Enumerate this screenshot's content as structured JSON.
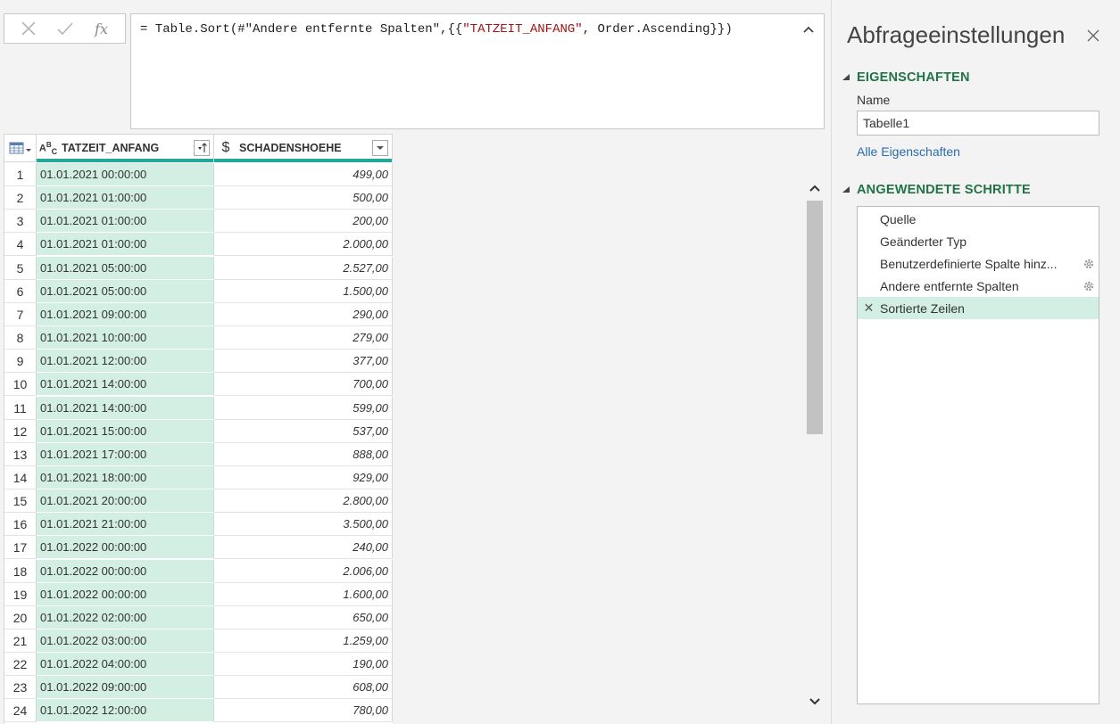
{
  "formula_bar": {
    "cancel_icon": "x-icon",
    "confirm_icon": "check-icon",
    "fx_label": "fx",
    "prefix": "= Table.Sort(#\"Andere entfernte Spalten\",{{",
    "string_part": "\"TATZEIT_ANFANG\"",
    "suffix": ", Order.Ascending}})"
  },
  "grid": {
    "columns": [
      {
        "name": "TATZEIT_ANFANG",
        "type_icon": "ABC",
        "sort": "ascending"
      },
      {
        "name": "SCHADENSHOEHE",
        "type_icon": "$"
      }
    ],
    "rows": [
      {
        "n": "1",
        "t": "01.01.2021 00:00:00",
        "v": "499,00"
      },
      {
        "n": "2",
        "t": "01.01.2021 01:00:00",
        "v": "500,00"
      },
      {
        "n": "3",
        "t": "01.01.2021 01:00:00",
        "v": "200,00"
      },
      {
        "n": "4",
        "t": "01.01.2021 01:00:00",
        "v": "2.000,00"
      },
      {
        "n": "5",
        "t": "01.01.2021 05:00:00",
        "v": "2.527,00"
      },
      {
        "n": "6",
        "t": "01.01.2021 05:00:00",
        "v": "1.500,00"
      },
      {
        "n": "7",
        "t": "01.01.2021 09:00:00",
        "v": "290,00"
      },
      {
        "n": "8",
        "t": "01.01.2021 10:00:00",
        "v": "279,00"
      },
      {
        "n": "9",
        "t": "01.01.2021 12:00:00",
        "v": "377,00"
      },
      {
        "n": "10",
        "t": "01.01.2021 14:00:00",
        "v": "700,00"
      },
      {
        "n": "11",
        "t": "01.01.2021 14:00:00",
        "v": "599,00"
      },
      {
        "n": "12",
        "t": "01.01.2021 15:00:00",
        "v": "537,00"
      },
      {
        "n": "13",
        "t": "01.01.2021 17:00:00",
        "v": "888,00"
      },
      {
        "n": "14",
        "t": "01.01.2021 18:00:00",
        "v": "929,00"
      },
      {
        "n": "15",
        "t": "01.01.2021 20:00:00",
        "v": "2.800,00"
      },
      {
        "n": "16",
        "t": "01.01.2021 21:00:00",
        "v": "3.500,00"
      },
      {
        "n": "17",
        "t": "01.01.2022 00:00:00",
        "v": "240,00"
      },
      {
        "n": "18",
        "t": "01.01.2022 00:00:00",
        "v": "2.006,00"
      },
      {
        "n": "19",
        "t": "01.01.2022 00:00:00",
        "v": "1.600,00"
      },
      {
        "n": "20",
        "t": "01.01.2022 02:00:00",
        "v": "650,00"
      },
      {
        "n": "21",
        "t": "01.01.2022 03:00:00",
        "v": "1.259,00"
      },
      {
        "n": "22",
        "t": "01.01.2022 04:00:00",
        "v": "190,00"
      },
      {
        "n": "23",
        "t": "01.01.2022 09:00:00",
        "v": "608,00"
      },
      {
        "n": "24",
        "t": "01.01.2022 12:00:00",
        "v": "780,00"
      }
    ]
  },
  "settings": {
    "title": "Abfrageeinstellungen",
    "properties_header": "EIGENSCHAFTEN",
    "name_label": "Name",
    "name_value": "Tabelle1",
    "all_properties_link": "Alle Eigenschaften",
    "steps_header": "ANGEWENDETE SCHRITTE",
    "steps": [
      {
        "label": "Quelle",
        "gear": false,
        "active": false
      },
      {
        "label": "Geänderter Typ",
        "gear": false,
        "active": false
      },
      {
        "label": "Benutzerdefinierte Spalte hinz...",
        "gear": true,
        "active": false
      },
      {
        "label": "Andere entfernte Spalten",
        "gear": true,
        "active": false
      },
      {
        "label": "Sortierte Zeilen",
        "gear": false,
        "active": true
      }
    ]
  },
  "colors": {
    "accent_green": "#217346",
    "selected_fill": "#d3eee2",
    "column_bar": "#22a89b",
    "link_blue": "#2a6cae"
  }
}
